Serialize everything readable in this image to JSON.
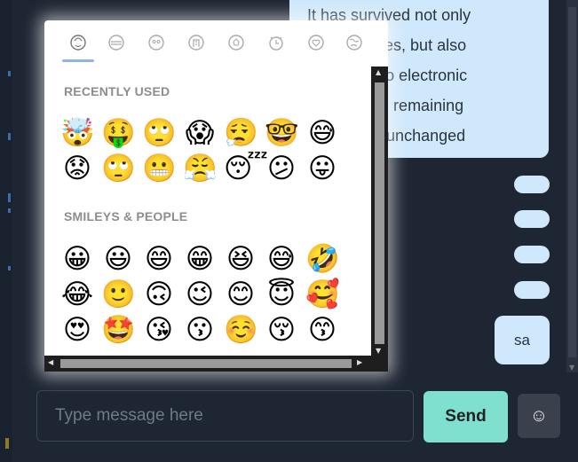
{
  "message_bubble": {
    "lines": [
      "It has survived not only",
      "five centuries, but also",
      "the leap into electronic",
      "typesetting, remaining",
      "essentially unchanged"
    ]
  },
  "sent_message": "sa",
  "input": {
    "placeholder": "Type message here",
    "value": ""
  },
  "send_label": "Send",
  "emoji_button_icon": "smiley-icon",
  "emoji_picker": {
    "categories": [
      "smileys-people-icon",
      "food-icon",
      "animals-icon",
      "buildings-icon",
      "activities-icon",
      "travel-icon",
      "symbols-icon",
      "flags-icon"
    ],
    "active_category": "smileys-people-icon",
    "sections": [
      {
        "title": "RECENTLY USED",
        "emojis": [
          "🤯",
          "🤑",
          "🙄",
          "😱",
          "😮‍💨",
          "🤓",
          "😅",
          "😟",
          "🙄",
          "😬",
          "😤",
          "😴",
          "😕",
          "😛"
        ]
      },
      {
        "title": "SMILEYS & PEOPLE",
        "emojis": [
          "😀",
          "😃",
          "😄",
          "😁",
          "😆",
          "😅",
          "🤣",
          "😂",
          "🙂",
          "🙃",
          "😉",
          "😊",
          "😇",
          "🥰",
          "😍",
          "🤩",
          "😘",
          "😗",
          "☺️",
          "😚",
          "😙"
        ]
      }
    ]
  },
  "colors": {
    "background": "#1e2633",
    "bubble": "#cfe8fb",
    "send_button": "#7fe0cf",
    "picker_underline": "#8cb7e8"
  }
}
